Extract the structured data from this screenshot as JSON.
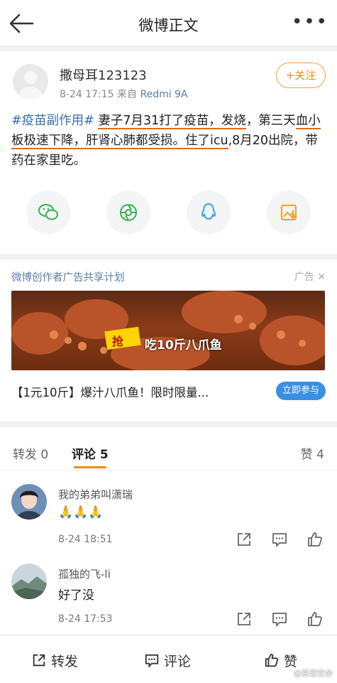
{
  "topbar": {
    "title": "微博正文"
  },
  "post": {
    "username": "撒母耳123123",
    "time": "8-24 17:15",
    "source_prefix": "来自",
    "source": "Redmi 9A",
    "follow_label": "+关注",
    "content": {
      "topic": "#疫苗副作用#",
      "seg1": "妻子7月31打了疫苗，发烧",
      "seg2": "，第三天",
      "seg3": "血小板极速下降，",
      "seg4": "肝肾心肺都受损",
      "seg5": "。住了icu",
      "seg6": ",8月20出院，带药在家里吃。"
    }
  },
  "share_icons": [
    "wechat-icon",
    "moments-icon",
    "qq-icon",
    "save-image-icon"
  ],
  "ad": {
    "title": "微博创作者广告共享计划",
    "tag": "广告",
    "banner_badge": "抢",
    "banner_text": "吃10斤八爪鱼",
    "line": "【1元10斤】爆汁八爪鱼！限时限量...",
    "button": "立即参与"
  },
  "tabs": {
    "repost": "转发 0",
    "comment": "评论 5",
    "like": "赞 4"
  },
  "comments": [
    {
      "name": "我的弟弟叫潇瑞",
      "text": "🙏🙏🙏",
      "time": "8-24 18:51"
    },
    {
      "name": "孤独的飞-li",
      "text": "好了没",
      "time": "8-24 17:53"
    }
  ],
  "bottombar": {
    "repost": "转发",
    "comment": "评论",
    "like": "赞"
  },
  "watermark": "@慈悲空余"
}
